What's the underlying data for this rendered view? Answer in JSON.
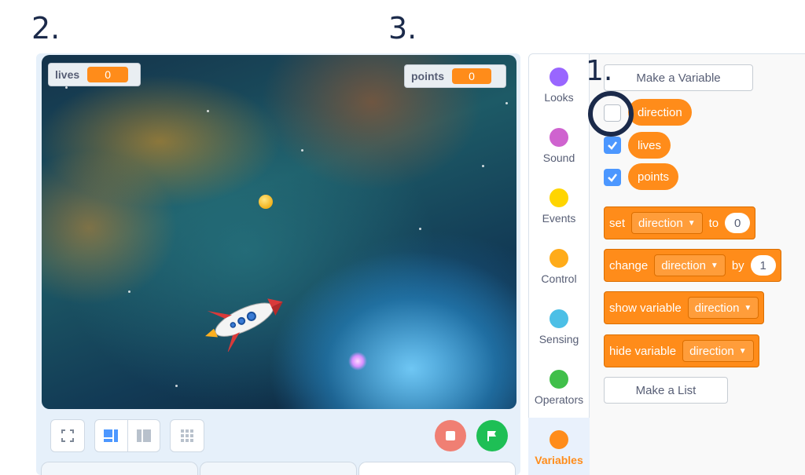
{
  "annotations": {
    "step1": "1.",
    "step2": "2.",
    "step3": "3."
  },
  "monitors": {
    "lives": {
      "label": "lives",
      "value": "0"
    },
    "points": {
      "label": "points",
      "value": "0"
    }
  },
  "categories": [
    {
      "label": "Looks",
      "color": "#9966ff"
    },
    {
      "label": "Sound",
      "color": "#cf63cf"
    },
    {
      "label": "Events",
      "color": "#ffd500"
    },
    {
      "label": "Control",
      "color": "#ffab19"
    },
    {
      "label": "Sensing",
      "color": "#4cbfe6"
    },
    {
      "label": "Operators",
      "color": "#40bf4a"
    },
    {
      "label": "Variables",
      "color": "#ff8c1a"
    }
  ],
  "palette": {
    "make_variable": "Make a Variable",
    "make_list": "Make a List",
    "variables": [
      {
        "name": "direction",
        "checked": false
      },
      {
        "name": "lives",
        "checked": true
      },
      {
        "name": "points",
        "checked": true
      }
    ],
    "blocks": {
      "set": {
        "verb": "set",
        "var": "direction",
        "prep": "to",
        "value": "0"
      },
      "change": {
        "verb": "change",
        "var": "direction",
        "prep": "by",
        "value": "1"
      },
      "show": {
        "verb": "show variable",
        "var": "direction"
      },
      "hide": {
        "verb": "hide variable",
        "var": "direction"
      }
    }
  },
  "colors": {
    "variables": "#ff8c1a",
    "accent": "#4c97ff",
    "go": "#1ebf55",
    "stop": "#f07f73"
  }
}
